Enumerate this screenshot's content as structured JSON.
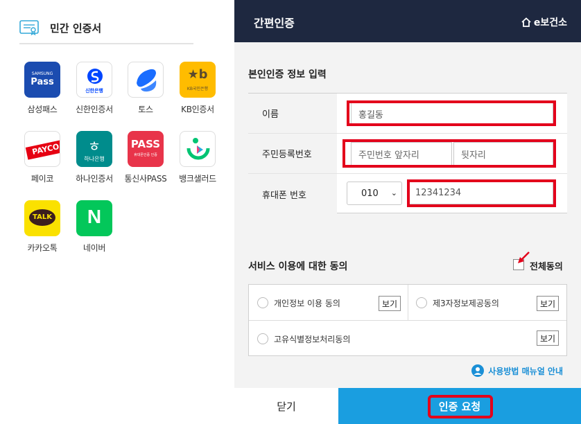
{
  "left": {
    "title": "민간 인증서",
    "apps": [
      {
        "label": "삼성패스",
        "icon_text": [
          "SAMSUNG",
          "Pass"
        ],
        "icon": "samsung-pass-icon",
        "color": "#1b4cb0"
      },
      {
        "label": "신한인증서",
        "icon_text": [
          "신한은행"
        ],
        "icon": "shinhan-icon",
        "color": "#0046ff"
      },
      {
        "label": "토스",
        "icon_text": [],
        "icon": "toss-icon",
        "color": "#1a6dff"
      },
      {
        "label": "KB인증서",
        "icon_text": [
          "KB국민은행"
        ],
        "icon": "kb-icon",
        "color": "#ffbc00"
      },
      {
        "label": "페이코",
        "icon_text": [
          "PAYCO"
        ],
        "icon": "payco-icon",
        "color": "#e60012"
      },
      {
        "label": "하나인증서",
        "icon_text": [
          "하나은행"
        ],
        "icon": "hana-icon",
        "color": "#008c8c"
      },
      {
        "label": "통신사PASS",
        "icon_text": [
          "PASS",
          "휴대폰인증 인증"
        ],
        "icon": "pass-icon",
        "color": "#e8344a"
      },
      {
        "label": "뱅크샐러드",
        "icon_text": [],
        "icon": "banksalad-icon",
        "color": "#00c473"
      },
      {
        "label": "카카오톡",
        "icon_text": [
          "TALK"
        ],
        "icon": "kakaotalk-icon",
        "color": "#fae100"
      },
      {
        "label": "네이버",
        "icon_text": [
          "N"
        ],
        "icon": "naver-icon",
        "color": "#03c75a"
      }
    ]
  },
  "right": {
    "header_title": "간편인증",
    "brand": "e보건소",
    "section_title": "본인인증 정보 입력",
    "fields": {
      "name_label": "이름",
      "name_value": "홍길동",
      "rrn_label": "주민등록번호",
      "rrn_front_placeholder": "주민번호 앞자리",
      "rrn_back_placeholder": "뒷자리",
      "phone_label": "휴대폰 번호",
      "phone_prefix": "010",
      "phone_value": "12341234"
    },
    "agree_title": "서비스 이용에 대한 동의",
    "agree_all": "전체동의",
    "agree_items": {
      "privacy": "개인정보 이용 동의",
      "third_party": "제3자정보제공동의",
      "unique_id": "고유식별정보처리동의"
    },
    "view_label": "보기",
    "manual_link": "사용방법 매뉴얼 안내",
    "close_button": "닫기",
    "request_button": "인증 요청"
  }
}
